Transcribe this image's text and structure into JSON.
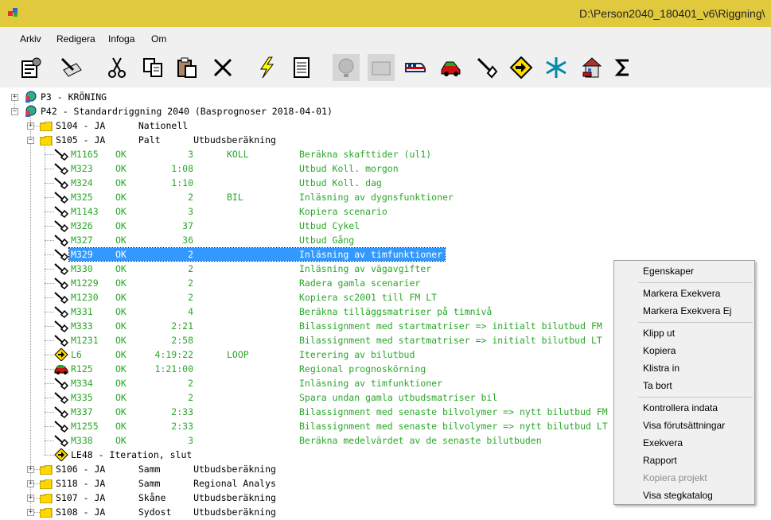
{
  "window": {
    "title": "D:\\Person2040_180401_v6\\Riggning\\"
  },
  "menu": [
    "Arkiv",
    "Redigera",
    "Infoga",
    "Om"
  ],
  "toolbar": [
    "properties-icon",
    "run-icon",
    "cut-icon",
    "copy-icon",
    "paste-icon",
    "delete-icon",
    "lightning-icon",
    "document-icon",
    "globe-icon",
    "folder-icon",
    "train-icon",
    "car-icon",
    "tool-icon",
    "arrow-sign-icon",
    "snowflake-icon",
    "house-icon",
    "sigma-icon"
  ],
  "tree": {
    "p3": "P3 - KRÖNING",
    "p42": "P42 - Standardriggning 2040 (Basprognoser 2018-04-01)",
    "s104": "S104 - JA      Nationell",
    "s105": "S105 - JA      Palt      Utbudsberäkning",
    "modules": [
      {
        "id": "M1165",
        "status": "OK",
        "value": "3",
        "tag": "KOLL",
        "desc": "Beräkna skafttider (ul1)",
        "icon": "tool"
      },
      {
        "id": "M323",
        "status": "OK",
        "value": "1:08",
        "tag": "",
        "desc": "Utbud Koll. morgon",
        "icon": "tool"
      },
      {
        "id": "M324",
        "status": "OK",
        "value": "1:10",
        "tag": "",
        "desc": "Utbud Koll. dag",
        "icon": "tool"
      },
      {
        "id": "M325",
        "status": "OK",
        "value": "2",
        "tag": "BIL",
        "desc": "Inläsning av dygnsfunktioner",
        "icon": "tool"
      },
      {
        "id": "M1143",
        "status": "OK",
        "value": "3",
        "tag": "",
        "desc": "Kopiera scenario",
        "icon": "tool"
      },
      {
        "id": "M326",
        "status": "OK",
        "value": "37",
        "tag": "",
        "desc": "Utbud Cykel",
        "icon": "tool"
      },
      {
        "id": "M327",
        "status": "OK",
        "value": "36",
        "tag": "",
        "desc": "Utbud Gång",
        "icon": "tool"
      },
      {
        "id": "M329",
        "status": "OK",
        "value": "2",
        "tag": "",
        "desc": "Inläsning av timfunktioner",
        "icon": "tool",
        "selected": true
      },
      {
        "id": "M330",
        "status": "OK",
        "value": "2",
        "tag": "",
        "desc": "Inläsning av vägavgifter",
        "icon": "tool"
      },
      {
        "id": "M1229",
        "status": "OK",
        "value": "2",
        "tag": "",
        "desc": "Radera gamla scenarier",
        "icon": "tool"
      },
      {
        "id": "M1230",
        "status": "OK",
        "value": "2",
        "tag": "",
        "desc": "Kopiera sc2001 till FM LT",
        "icon": "tool"
      },
      {
        "id": "M331",
        "status": "OK",
        "value": "4",
        "tag": "",
        "desc": "Beräkna tilläggsmatriser på timnivå",
        "icon": "tool"
      },
      {
        "id": "M333",
        "status": "OK",
        "value": "2:21",
        "tag": "",
        "desc": "Bilassignment med startmatriser => initialt bilutbud FM",
        "icon": "tool"
      },
      {
        "id": "M1231",
        "status": "OK",
        "value": "2:58",
        "tag": "",
        "desc": "Bilassignment med startmatriser => initialt bilutbud LT",
        "icon": "tool"
      },
      {
        "id": "L6",
        "status": "OK",
        "value": "4:19:22",
        "tag": "LOOP",
        "desc": "Iterering av bilutbud",
        "icon": "loop"
      },
      {
        "id": "R125",
        "status": "OK",
        "value": "1:21:00",
        "tag": "",
        "desc": "Regional prognoskörning",
        "icon": "car"
      },
      {
        "id": "M334",
        "status": "OK",
        "value": "2",
        "tag": "",
        "desc": "Inläsning av timfunktioner",
        "icon": "tool"
      },
      {
        "id": "M335",
        "status": "OK",
        "value": "2",
        "tag": "",
        "desc": "Spara undan gamla utbudsmatriser bil",
        "icon": "tool"
      },
      {
        "id": "M337",
        "status": "OK",
        "value": "2:33",
        "tag": "",
        "desc": "Bilassignment med senaste bilvolymer => nytt bilutbud FM",
        "icon": "tool"
      },
      {
        "id": "M1255",
        "status": "OK",
        "value": "2:33",
        "tag": "",
        "desc": "Bilassignment med senaste bilvolymer => nytt bilutbud LT",
        "icon": "tool"
      },
      {
        "id": "M338",
        "status": "OK",
        "value": "3",
        "tag": "",
        "desc": "Beräkna medelvärdet av de senaste bilutbuden",
        "icon": "tool"
      }
    ],
    "le48": "LE48 - Iteration, slut",
    "s106": "S106 - JA      Samm      Utbudsberäkning",
    "s118": "S118 - JA      Samm      Regional Analys",
    "s107": "S107 - JA      Skåne     Utbudsberäkning",
    "s108": "S108 - JA      Sydost    Utbudsberäkning"
  },
  "context_menu": {
    "egenskaper": "Egenskaper",
    "markera": "Markera Exekvera",
    "markera_ej": "Markera Exekvera Ej",
    "klipp": "Klipp ut",
    "kopiera": "Kopiera",
    "klistra": "Klistra in",
    "tabort": "Ta bort",
    "kontrollera": "Kontrollera indata",
    "visa_forut": "Visa förutsättningar",
    "exekvera": "Exekvera",
    "rapport": "Rapport",
    "kopiera_projekt": "Kopiera projekt",
    "visa_steg": "Visa stegkatalog"
  },
  "colors": {
    "titlebar": "#e1c93d",
    "ok_text": "#2aa72a",
    "selection": "#3399ff"
  }
}
